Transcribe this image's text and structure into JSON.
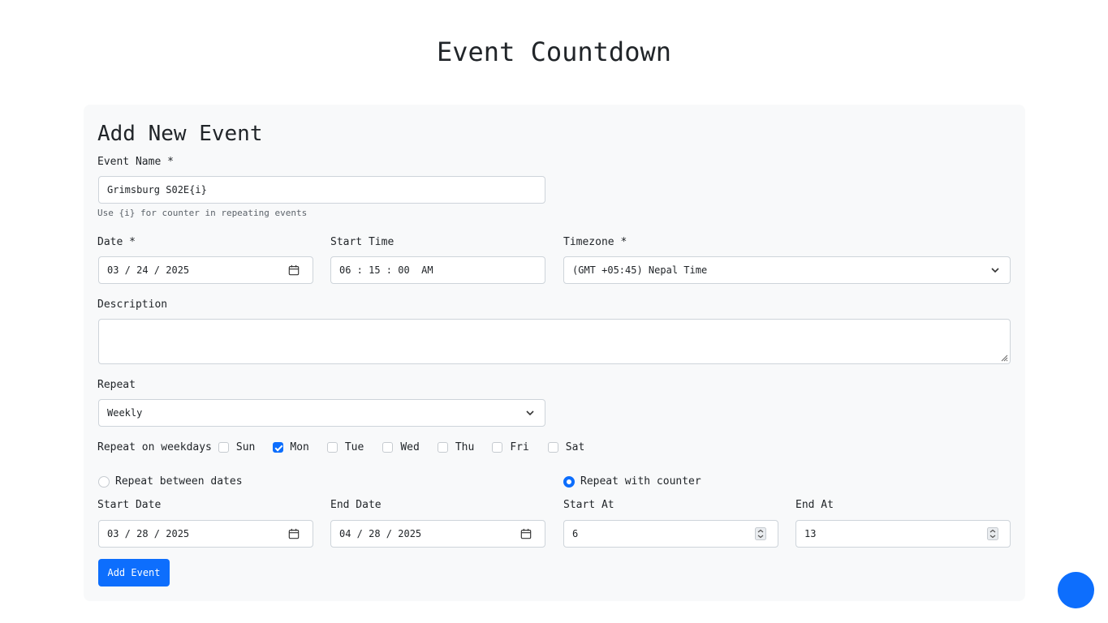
{
  "page": {
    "title": "Event Countdown"
  },
  "form": {
    "title": "Add New Event",
    "event_name": {
      "label": "Event Name *",
      "value": "Grimsburg S02E{i}",
      "help": "Use {i} for counter in repeating events"
    },
    "date": {
      "label": "Date *",
      "value": "03 / 24 / 2025"
    },
    "start_time": {
      "label": "Start Time",
      "value": "06 : 15 : 00  AM"
    },
    "timezone": {
      "label": "Timezone *",
      "value": "(GMT +05:45) Nepal Time"
    },
    "description": {
      "label": "Description",
      "value": ""
    },
    "repeat": {
      "label": "Repeat",
      "value": "Weekly"
    },
    "weekdays": {
      "label": "Repeat on weekdays",
      "days": [
        {
          "label": "Sun",
          "checked": false
        },
        {
          "label": "Mon",
          "checked": true
        },
        {
          "label": "Tue",
          "checked": false
        },
        {
          "label": "Wed",
          "checked": false
        },
        {
          "label": "Thu",
          "checked": false
        },
        {
          "label": "Fri",
          "checked": false
        },
        {
          "label": "Sat",
          "checked": false
        }
      ]
    },
    "repeat_mode": {
      "between_dates": {
        "label": "Repeat between dates",
        "selected": false
      },
      "with_counter": {
        "label": "Repeat with counter",
        "selected": true
      }
    },
    "start_date": {
      "label": "Start Date",
      "value": "03 / 28 / 2025"
    },
    "end_date": {
      "label": "End Date",
      "value": "04 / 28 / 2025"
    },
    "start_at": {
      "label": "Start At",
      "value": "6"
    },
    "end_at": {
      "label": "End At",
      "value": "13"
    },
    "submit_label": "Add Event"
  },
  "colors": {
    "accent": "#0d6efd",
    "card_bg": "#f8f9fa",
    "border": "#ced4da"
  }
}
